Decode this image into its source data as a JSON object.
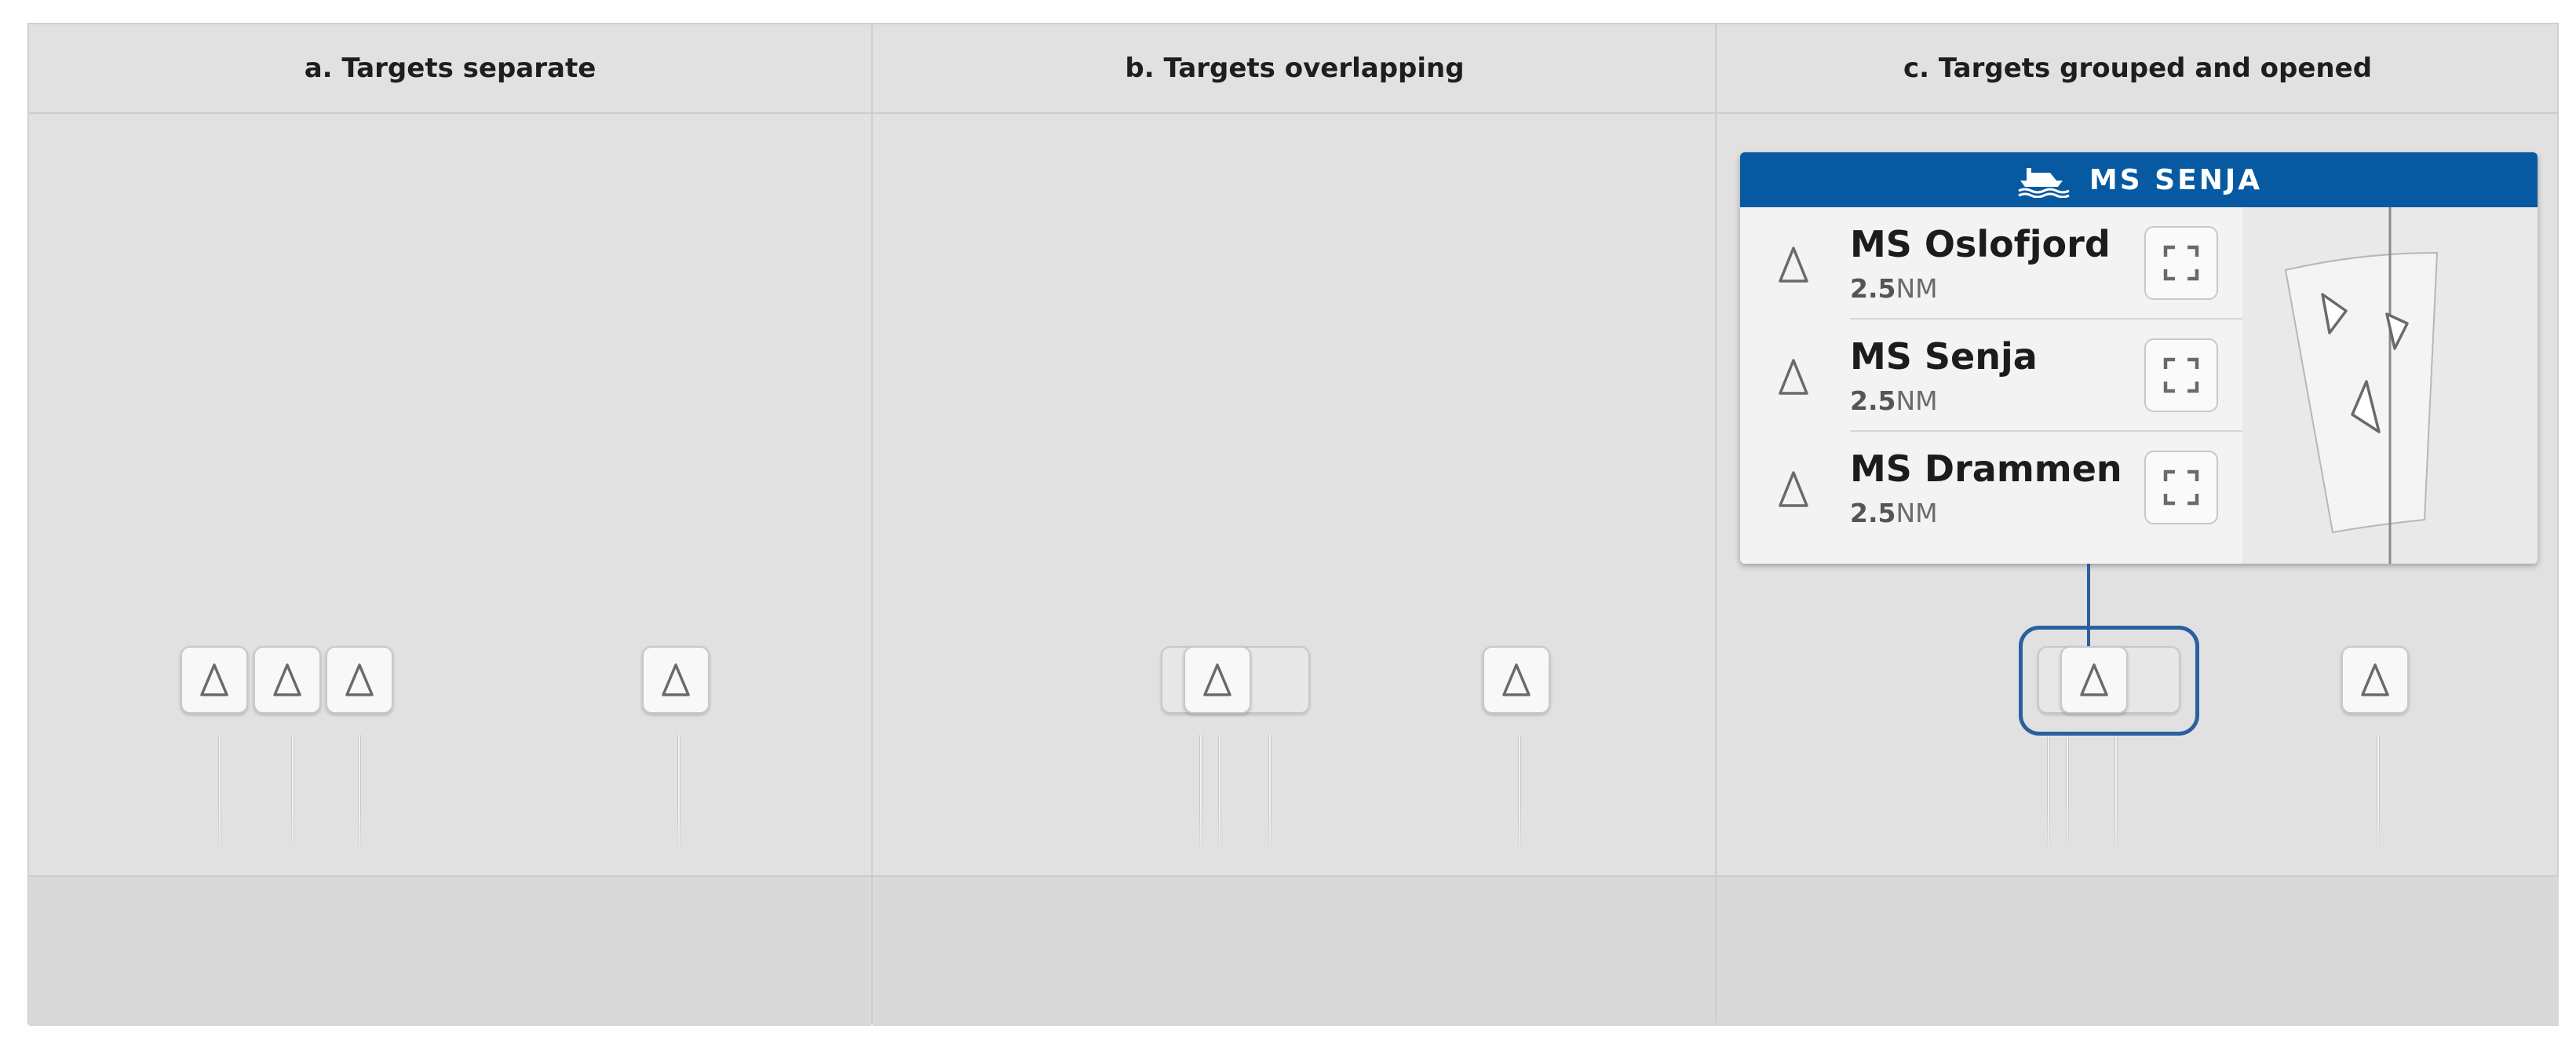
{
  "panels": [
    {
      "id": "a",
      "title": "a. Targets separate"
    },
    {
      "id": "b",
      "title": "b. Targets overlapping"
    },
    {
      "id": "c",
      "title": "c. Targets grouped and opened"
    }
  ],
  "popup": {
    "title": "MS SENJA",
    "title_icon": "ship-icon",
    "targets": [
      {
        "name": "MS Oslofjord",
        "distance_value": "2.5",
        "distance_unit": "NM",
        "icon": "target-triangle-icon",
        "action_icon": "focus-frame-icon"
      },
      {
        "name": "MS Senja",
        "distance_value": "2.5",
        "distance_unit": "NM",
        "icon": "target-triangle-icon",
        "action_icon": "focus-frame-icon"
      },
      {
        "name": "MS Drammen",
        "distance_value": "2.5",
        "distance_unit": "NM",
        "icon": "target-triangle-icon",
        "action_icon": "focus-frame-icon"
      }
    ],
    "radar_icon": "radar-sector-icon"
  },
  "colors": {
    "accent": "#075aa2",
    "group_outline": "#2a5fa0",
    "panel_background": "#e1e1e1",
    "footer_background": "#d9d9d9",
    "marker_stroke": "#6a6a6a"
  }
}
